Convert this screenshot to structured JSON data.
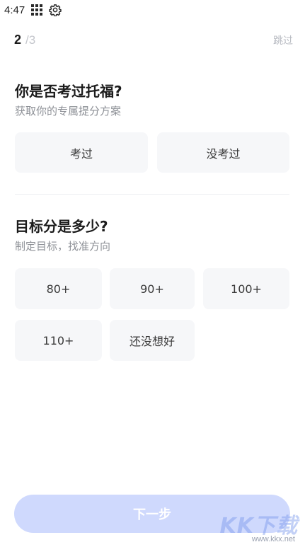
{
  "status_bar": {
    "time": "4:47"
  },
  "progress": {
    "current": "2",
    "total": "/3"
  },
  "skip_label": "跳过",
  "question1": {
    "title": "你是否考过托福?",
    "subtitle": "获取你的专属提分方案",
    "options": [
      "考过",
      "没考过"
    ]
  },
  "question2": {
    "title": "目标分是多少?",
    "subtitle": "制定目标，找准方向",
    "options": [
      "80+",
      "90+",
      "100+",
      "110+",
      "还没想好"
    ]
  },
  "next_button": {
    "label": "下一步"
  },
  "watermark": {
    "logo": "KK下载",
    "url": "www.kkx.net"
  },
  "colors": {
    "accent_disabled": "#cfd9fd",
    "option_bg": "#f6f7f9"
  }
}
